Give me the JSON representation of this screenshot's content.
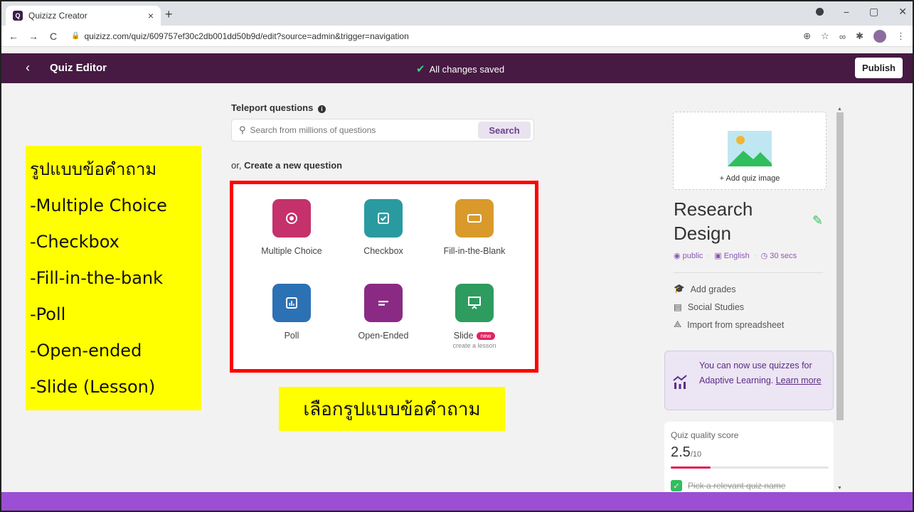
{
  "browser": {
    "tab_title": "Quizizz Creator",
    "tab_close": "×",
    "new_tab": "+",
    "url": "quizizz.com/quiz/609757ef30c2db001dd50b9d/edit?source=admin&trigger=navigation",
    "window_controls": [
      "−",
      "▢",
      "✕"
    ]
  },
  "header": {
    "back_icon": "‹",
    "title": "Quiz Editor",
    "status": "All changes saved",
    "publish_label": "Publish"
  },
  "teleport": {
    "label": "Teleport questions",
    "placeholder": "Search from millions of questions",
    "search_label": "Search",
    "or_prefix": "or,",
    "create_label": "Create a new question"
  },
  "question_types": [
    {
      "label": "Multiple Choice",
      "color": "#c5316a",
      "icon": "radio-icon"
    },
    {
      "label": "Checkbox",
      "color": "#2a9aa1",
      "icon": "checkbox-icon"
    },
    {
      "label": "Fill-in-the-Blank",
      "color": "#d99a2b",
      "icon": "blank-box-icon"
    },
    {
      "label": "Poll",
      "color": "#2d71b5",
      "icon": "bar-chart-icon"
    },
    {
      "label": "Open-Ended",
      "color": "#8a2a84",
      "icon": "text-lines-icon"
    },
    {
      "label": "Slide",
      "color": "#2e9b5f",
      "icon": "presentation-icon",
      "badge": "new",
      "sub": "create a lesson"
    }
  ],
  "annotations": {
    "left_lines": [
      "รูปแบบข้อคำถาม",
      "-Multiple Choice",
      "-Checkbox",
      "-Fill-in-the-bank",
      "-Poll",
      "-Open-ended",
      "-Slide (Lesson)"
    ],
    "bottom": "เลือกรูปแบบข้อคำถาม"
  },
  "quiz": {
    "add_image": "+ Add quiz image",
    "title": "Research Design",
    "visibility": "public",
    "language": "English",
    "duration": "30 secs",
    "actions": [
      "Add grades",
      "Social Studies",
      "Import from spreadsheet"
    ],
    "adaptive_text": "You can now use quizzes for Adaptive Learning.",
    "adaptive_link": "Learn more",
    "quality_label": "Quiz quality score",
    "quality_score": "2.5",
    "quality_max": "/10",
    "quality_fraction": 0.25,
    "quality_item": "Pick a relevant quiz name"
  },
  "colors": {
    "header_bg": "#461a42",
    "accent": "#8a56b4",
    "bottom_bar": "#9c4fd4",
    "highlight": "#ffff00",
    "annotation_border": "#ff0000"
  }
}
